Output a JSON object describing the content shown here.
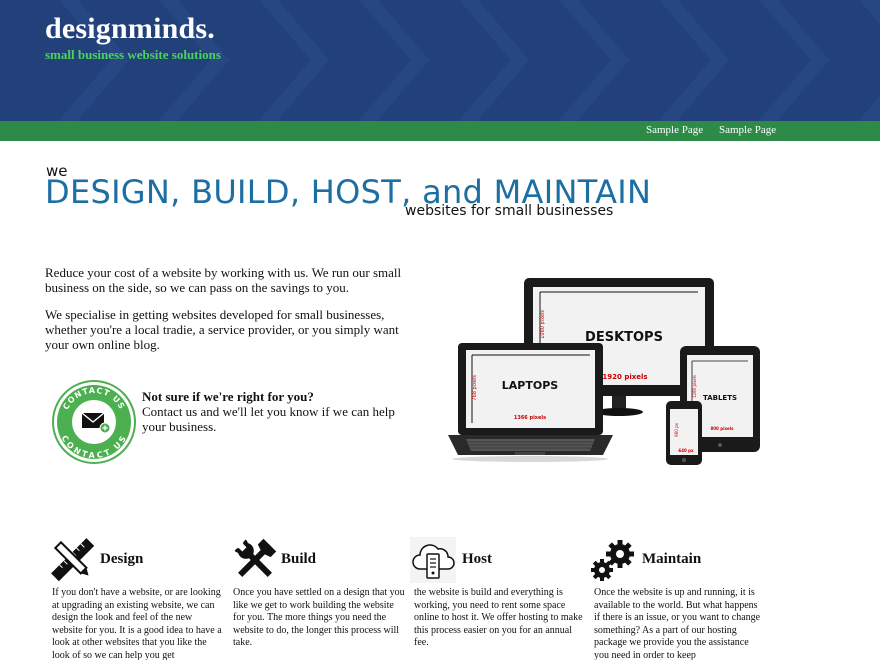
{
  "header": {
    "title": "designminds.",
    "tagline": "small business website solutions",
    "bg_color": "#22417a",
    "tagline_color": "#4cd25b"
  },
  "nav": {
    "bg_color": "#2e8b47",
    "items": [
      {
        "label": "Sample Page"
      },
      {
        "label": "Sample Page"
      }
    ]
  },
  "hero": {
    "we": "we",
    "headline": "DESIGN, BUILD, HOST, and MAINTAIN",
    "subline": "websites for small businesses",
    "headline_color": "#1d6ea3"
  },
  "intro": {
    "p1": "Reduce your cost of a website by working with us. We run our small business on the side, so we can pass on the savings to you.",
    "p2": "We specialise in getting websites developed for small businesses, whether you're a local tradie, a service provider, or you simply want your own online blog."
  },
  "contact": {
    "badge_text_top": "CONTACT US",
    "badge_text_bottom": "CONTACT US",
    "title": "Not sure if we're right for you?",
    "text": "Contact us and we'll let you know if we can help your business."
  },
  "devices": {
    "desktop_label": "DESKTOPS",
    "desktop_width": "1920 pixels",
    "desktop_height": "1080 pixels",
    "laptop_label": "LAPTOPS",
    "laptop_width": "1366 pixels",
    "laptop_height": "768 pixels",
    "tablet_label": "TABLETS",
    "tablet_width": "800 pixels",
    "tablet_height": "1280 pixels",
    "phone_width": "640 px",
    "phone_height": "960 px"
  },
  "services": [
    {
      "icon": "ruler-pencil-icon",
      "title": "Design",
      "text": "If you don't have a website, or are looking at upgrading an existing website, we can design the look and feel of the new website for you. It is a good idea to have a look at other websites that you like the look of so we can help you get"
    },
    {
      "icon": "tools-icon",
      "title": "Build",
      "text": "Once you have settled on a design that you like we get to work building the website for you. The more things you need the website to do, the longer this process will take."
    },
    {
      "icon": "cloud-server-icon",
      "title": "Host",
      "text": "the website is build and everything is working, you need to rent some space online to host it. We offer hosting to make this process easier on you for an annual fee."
    },
    {
      "icon": "gears-icon",
      "title": "Maintain",
      "text": "Once the website is up and running, it is available to the world. But what happens if there is an issue, or you want to change something? As a part of our hosting package we provide you the assistance you need in order to keep"
    }
  ]
}
